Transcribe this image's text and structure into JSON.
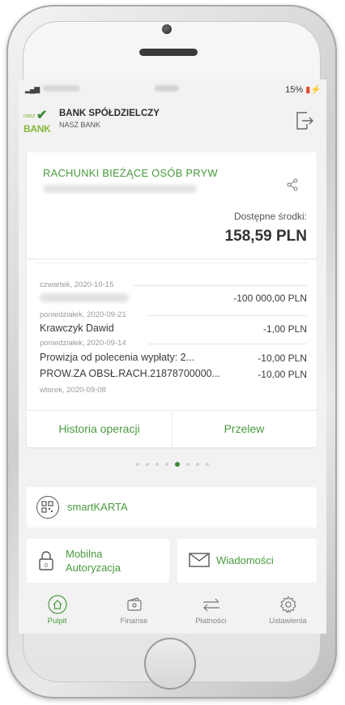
{
  "status_bar": {
    "battery": "15%"
  },
  "header": {
    "bank_name": "BANK SPÓŁDZIELCZY",
    "bank_sub": "NASZ BANK",
    "logo_small": "nasz",
    "logo_big": "BANK"
  },
  "account": {
    "title": "RACHUNKI BIEŻĄCE OSÓB PRYW",
    "available_label": "Dostępne środki:",
    "balance": "158,59 PLN"
  },
  "transactions": [
    {
      "date": "czwartek, 2020-10-15",
      "name": "",
      "amount": "-100 000,00 PLN"
    },
    {
      "date": "poniedziałek, 2020-09-21",
      "name": "Krawczyk Dawid",
      "amount": "-1,00 PLN"
    },
    {
      "date": "poniedziałek, 2020-09-14",
      "name": "Prowizja od polecenia wypłaty: 2...",
      "amount": "-10,00 PLN"
    },
    {
      "date": "",
      "name": "PROW.ZA OBSŁ.RACH.21878700000...",
      "amount": "-10,00 PLN"
    },
    {
      "date": "wtorek, 2020-09-08",
      "name": "",
      "amount": ""
    }
  ],
  "actions": {
    "history": "Historia operacji",
    "transfer": "Przelew"
  },
  "pager": {
    "count": 8,
    "active_index": 4
  },
  "tiles": {
    "smart": "smartKARTA",
    "mobilna_1": "Mobilna",
    "mobilna_2": "Autoryzacja",
    "messages": "Wiadomości"
  },
  "tabs": [
    {
      "label": "Pulpit",
      "icon": "home-icon",
      "active": true
    },
    {
      "label": "Finanse",
      "icon": "wallet-icon",
      "active": false
    },
    {
      "label": "Płatności",
      "icon": "transfer-arrows-icon",
      "active": false
    },
    {
      "label": "Ustawienia",
      "icon": "gear-icon",
      "active": false
    }
  ],
  "colors": {
    "accent": "#4a9a3f",
    "logo_green": "#86b83a",
    "dark_green": "#3d8a3a"
  }
}
